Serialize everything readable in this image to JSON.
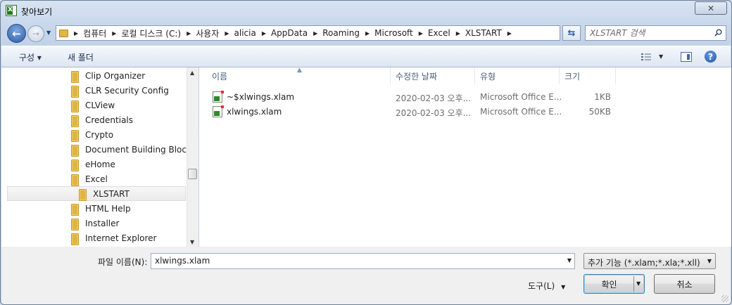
{
  "window": {
    "title": "찾아보기"
  },
  "address": {
    "crumbs": [
      "컴퓨터",
      "로컬 디스크 (C:)",
      "사용자",
      "alicia",
      "AppData",
      "Roaming",
      "Microsoft",
      "Excel",
      "XLSTART"
    ]
  },
  "search": {
    "placeholder": "XLSTART 검색"
  },
  "toolbar": {
    "organize": "구성 ▾",
    "new_folder": "새 폴더"
  },
  "tree": {
    "items": [
      {
        "label": "Clip Organizer",
        "indent": 0
      },
      {
        "label": "CLR Security Config",
        "indent": 0
      },
      {
        "label": "CLView",
        "indent": 0
      },
      {
        "label": "Credentials",
        "indent": 0
      },
      {
        "label": "Crypto",
        "indent": 0
      },
      {
        "label": "Document Building Blocks",
        "indent": 0
      },
      {
        "label": "eHome",
        "indent": 0
      },
      {
        "label": "Excel",
        "indent": 0
      },
      {
        "label": "XLSTART",
        "indent": 1,
        "selected": true
      },
      {
        "label": "HTML Help",
        "indent": 0
      },
      {
        "label": "Installer",
        "indent": 0
      },
      {
        "label": "Internet Explorer",
        "indent": 0
      }
    ]
  },
  "columns": {
    "name": "이름",
    "date": "수정한 날짜",
    "type": "유형",
    "size": "크기"
  },
  "files": [
    {
      "name": "~$xlwings.xlam",
      "date": "2020-02-03 오후...",
      "type": "Microsoft Office E...",
      "size": "1KB"
    },
    {
      "name": "xlwings.xlam",
      "date": "2020-02-03 오후...",
      "type": "Microsoft Office E...",
      "size": "50KB"
    }
  ],
  "bottom": {
    "filename_label": "파일 이름(N):",
    "filename_value": "xlwings.xlam",
    "filter": "추가 기능 (*.xlam;*.xla;*.xll)",
    "tools": "도구(L)",
    "open": "확인",
    "cancel": "취소"
  }
}
